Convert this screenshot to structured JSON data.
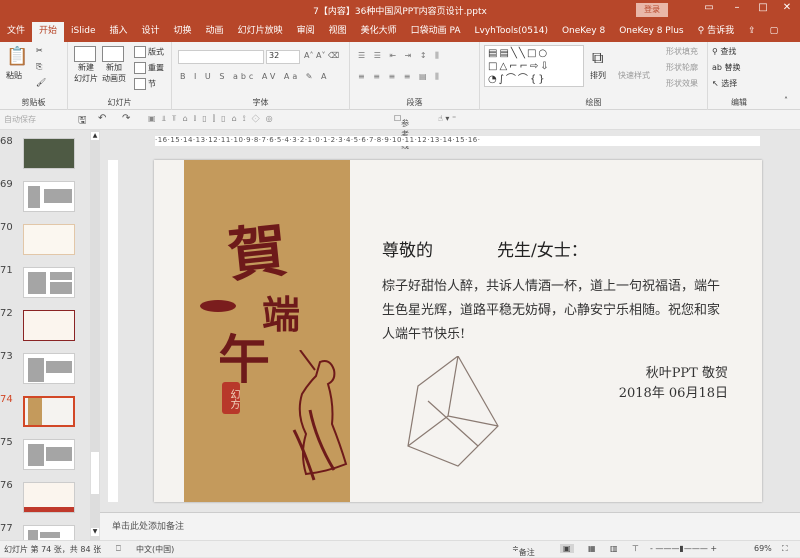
{
  "window": {
    "title": "7【内容】36种中国风PPT内容页设计.pptx",
    "login": "登录",
    "accent": "#b7472a"
  },
  "tabs": [
    "文件",
    "开始",
    "iSlide",
    "插入",
    "设计",
    "切换",
    "动画",
    "幻灯片放映",
    "审阅",
    "视图",
    "美化大师",
    "口袋动画 PA",
    "LvyhTools(0514)",
    "OneKey 8",
    "OneKey 8 Plus",
    "告诉我"
  ],
  "active_tab": "开始",
  "ribbon": {
    "clipboard": {
      "label": "剪贴板",
      "paste": "粘贴"
    },
    "slides": {
      "label": "幻灯片",
      "new_slide": "新建\n幻灯片",
      "new_anim": "新加\n动画页",
      "layout": "版式",
      "reset": "重置",
      "section": "节"
    },
    "font": {
      "label": "字体",
      "font_name": "",
      "font_size": "32"
    },
    "paragraph": {
      "label": "段落"
    },
    "drawing": {
      "label": "绘图",
      "arrange": "排列",
      "quick_styles": "快速样式",
      "fill": "形状填充",
      "outline": "形状轮廓",
      "effects": "形状效果"
    },
    "editing": {
      "label": "编辑",
      "find": "查找",
      "replace": "替换",
      "select": "选择"
    }
  },
  "qat": {
    "autosave": "自动保存",
    "guides": "参考线"
  },
  "ruler": "·16·15·14·13·12·11·10·9·8·7·6·5·4·3·2·1·0·1·2·3·4·5·6·7·8·9·10·11·12·13·14·15·16·",
  "thumbnails": [
    {
      "num": "68"
    },
    {
      "num": "69"
    },
    {
      "num": "70"
    },
    {
      "num": "71"
    },
    {
      "num": "72"
    },
    {
      "num": "73"
    },
    {
      "num": "74",
      "selected": true
    },
    {
      "num": "75"
    },
    {
      "num": "76"
    },
    {
      "num": "77"
    }
  ],
  "slide": {
    "calligraphy": [
      "賀",
      "端",
      "午"
    ],
    "seal": "幻方",
    "greeting_left": "尊敬的",
    "greeting_right": "先生/女士：",
    "body": "棕子好甜怡人醉，共诉人情酒一杯，道上一句祝福语，端午生色星光辉，道路平稳无妨碍，心静安宁乐相随。祝您和家人端午节快乐!",
    "signature": "秋叶PPT  敬贺",
    "date": "2018年 06月18日",
    "banner_color": "#c49a5c"
  },
  "notes_placeholder": "单击此处添加备注",
  "status": {
    "slide_info": "幻灯片 第 74 张，共 84 张",
    "language": "中文(中国)",
    "notes": "备注",
    "zoom": "69%"
  }
}
